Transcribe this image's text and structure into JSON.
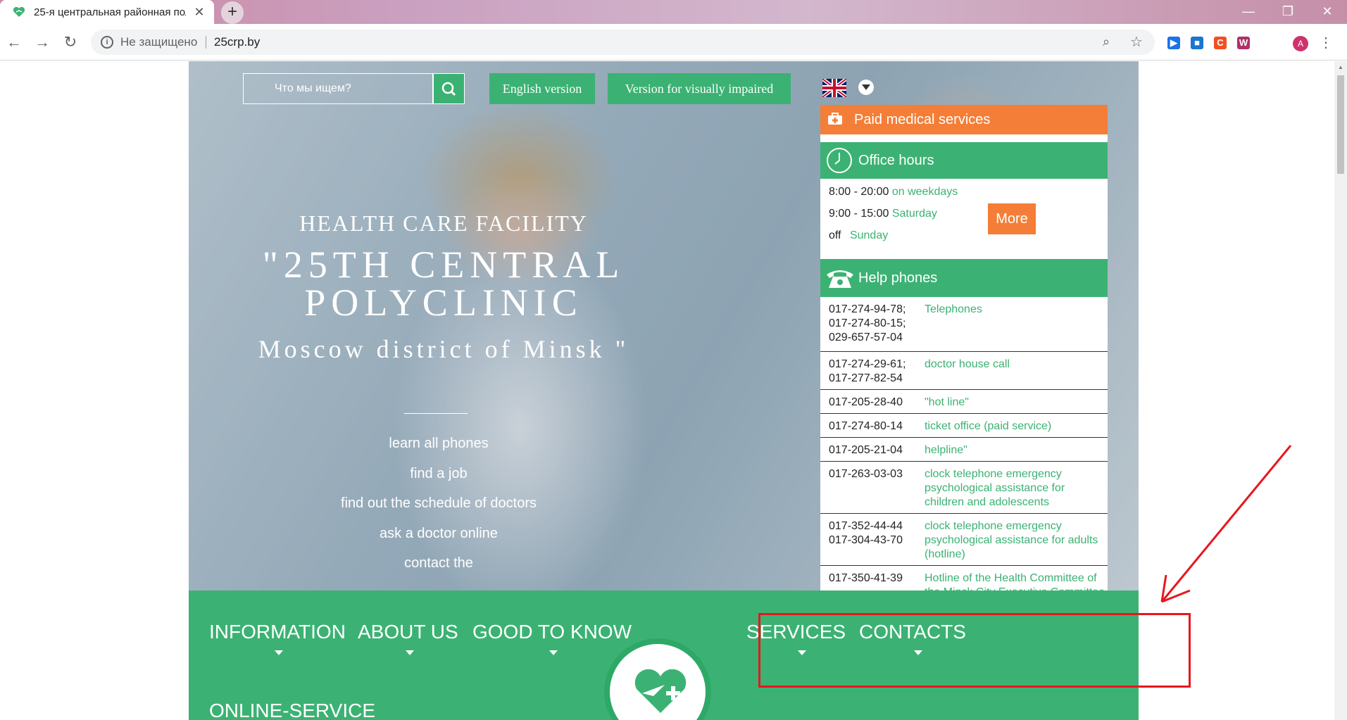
{
  "browser": {
    "tab_title": "25-я центральная районная пол",
    "new_tab": "+",
    "tab_close": "✕",
    "security_label": "Не защищено",
    "url": "25crp.by",
    "avatar_letter": "A",
    "extensions": [
      {
        "name": "play-extension",
        "color": "#1a73e8",
        "glyph": "▶"
      },
      {
        "name": "box-extension",
        "color": "#1976d2",
        "glyph": "■"
      },
      {
        "name": "c-extension",
        "color": "#f25022",
        "glyph": "C"
      },
      {
        "name": "w-extension",
        "color": "#b0306a",
        "glyph": "W"
      }
    ]
  },
  "header": {
    "search_placeholder": "Что мы ищем?",
    "english_button": "English version",
    "impaired_button": "Version for visually impaired"
  },
  "hero": {
    "subtitle": "HEALTH CARE FACILITY",
    "title_line1": "\"25TH CENTRAL",
    "title_line2": "POLYCLINIC",
    "title_line3": "Moscow district of Minsk \"",
    "links": [
      "learn all phones",
      "find a job",
      "find out the schedule of doctors",
      "ask a doctor online",
      "contact the"
    ]
  },
  "panel": {
    "paid_label": "Paid medical services",
    "hours_label": "Office hours",
    "hours": [
      {
        "time": "8:00 - 20:00",
        "day": "on weekdays"
      },
      {
        "time": "9:00 - 15:00",
        "day": "Saturday"
      },
      {
        "time": "off",
        "day": "Sunday"
      }
    ],
    "more_button": "More",
    "phones_label": "Help phones",
    "phones": [
      {
        "numbers": "017-274-94-78;\n017-274-80-15;\n029-657-57-04",
        "desc": "Telephones"
      },
      {
        "numbers": "017-274-29-61;\n017-277-82-54",
        "desc": "doctor house call"
      },
      {
        "numbers": "017-205-28-40",
        "desc": "\"hot line\""
      },
      {
        "numbers": "017-274-80-14",
        "desc": "ticket office (paid service)"
      },
      {
        "numbers": "017-205-21-04",
        "desc": "helpline\""
      },
      {
        "numbers": "017-263-03-03",
        "desc": "clock telephone emergency psychological assistance for children and adolescents"
      },
      {
        "numbers": "017-352-44-44\n017-304-43-70",
        "desc": "clock telephone emergency psychological assistance for adults (hotline)"
      },
      {
        "numbers": "017-350-41-39",
        "desc": "Hotline of the Health Committee of the Minsk City Executive Committee"
      }
    ]
  },
  "nav": {
    "items": [
      "INFORMATION",
      "ABOUT US",
      "GOOD TO KNOW",
      "SERVICES",
      "CONTACTS",
      "ONLINE-SERVICE"
    ]
  },
  "colors": {
    "green": "#3bb273",
    "orange": "#f47e37",
    "annotation_red": "#e8161e"
  }
}
